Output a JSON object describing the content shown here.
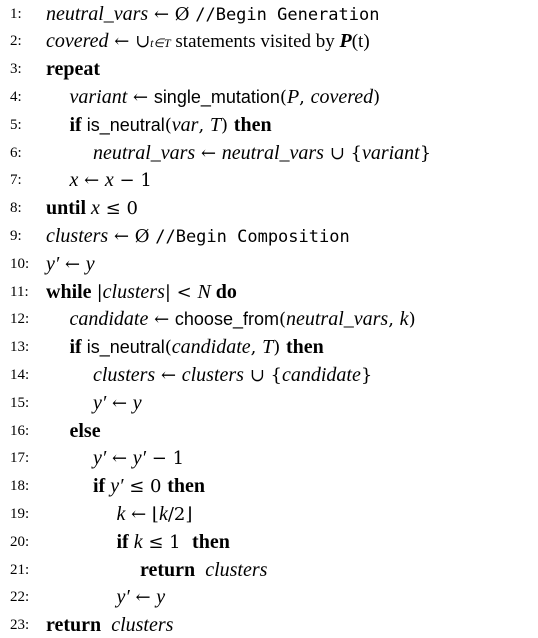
{
  "lines": [
    {
      "num": "1:",
      "indent": 0,
      "tokens": [
        {
          "t": "neutral_vars",
          "c": "v"
        },
        {
          "t": " ← Ø ",
          "c": "op"
        },
        {
          "t": "//Begin Generation",
          "c": "tt"
        }
      ]
    },
    {
      "num": "2:",
      "indent": 0,
      "tokens": [
        {
          "t": "covered",
          "c": "v"
        },
        {
          "t": " ← ∪",
          "c": "op"
        },
        {
          "t": "t∈T",
          "c": "v sub"
        },
        {
          "t": " statements visited by ",
          "c": "tx"
        },
        {
          "t": "P",
          "c": "v kw"
        },
        {
          "t": "(t)",
          "c": "tx"
        }
      ]
    },
    {
      "num": "3:",
      "indent": 0,
      "tokens": [
        {
          "t": "repeat",
          "c": "kw"
        }
      ]
    },
    {
      "num": "4:",
      "indent": 1,
      "tokens": [
        {
          "t": "variant",
          "c": "v"
        },
        {
          "t": " ← ",
          "c": "op"
        },
        {
          "t": "single_mutation",
          "c": "fn"
        },
        {
          "t": "(",
          "c": "op"
        },
        {
          "t": "P",
          "c": "v"
        },
        {
          "t": ", ",
          "c": "op"
        },
        {
          "t": "covered",
          "c": "v"
        },
        {
          "t": ")",
          "c": "op"
        }
      ]
    },
    {
      "num": "5:",
      "indent": 1,
      "tokens": [
        {
          "t": "if ",
          "c": "kw"
        },
        {
          "t": "is_neutral",
          "c": "fn"
        },
        {
          "t": "(",
          "c": "op"
        },
        {
          "t": "var",
          "c": "v"
        },
        {
          "t": ", ",
          "c": "op"
        },
        {
          "t": "T",
          "c": "v"
        },
        {
          "t": ") ",
          "c": "op"
        },
        {
          "t": "then",
          "c": "kw"
        }
      ]
    },
    {
      "num": "6:",
      "indent": 2,
      "tokens": [
        {
          "t": "neutral_vars",
          "c": "v"
        },
        {
          "t": " ← ",
          "c": "op"
        },
        {
          "t": "neutral_vars",
          "c": "v"
        },
        {
          "t": " ∪ {",
          "c": "op"
        },
        {
          "t": "variant",
          "c": "v"
        },
        {
          "t": "}",
          "c": "op"
        }
      ]
    },
    {
      "num": "7:",
      "indent": 1,
      "tokens": [
        {
          "t": "x",
          "c": "v"
        },
        {
          "t": " ← ",
          "c": "op"
        },
        {
          "t": "x",
          "c": "v"
        },
        {
          "t": " − 1",
          "c": "op"
        }
      ]
    },
    {
      "num": "8:",
      "indent": 0,
      "tokens": [
        {
          "t": "until ",
          "c": "kw"
        },
        {
          "t": "x",
          "c": "v"
        },
        {
          "t": " ≤ 0",
          "c": "op"
        }
      ]
    },
    {
      "num": "9:",
      "indent": 0,
      "tokens": [
        {
          "t": "clusters",
          "c": "v"
        },
        {
          "t": " ← Ø ",
          "c": "op"
        },
        {
          "t": "//Begin Composition",
          "c": "tt"
        }
      ]
    },
    {
      "num": "10:",
      "indent": 0,
      "tokens": [
        {
          "t": "y′",
          "c": "v"
        },
        {
          "t": " ← ",
          "c": "op"
        },
        {
          "t": "y",
          "c": "v"
        }
      ]
    },
    {
      "num": "11:",
      "indent": 0,
      "tokens": [
        {
          "t": "while ",
          "c": "kw"
        },
        {
          "t": "|",
          "c": "op"
        },
        {
          "t": "clusters",
          "c": "v"
        },
        {
          "t": "| < ",
          "c": "op"
        },
        {
          "t": "N",
          "c": "v"
        },
        {
          "t": " do",
          "c": "kw"
        }
      ]
    },
    {
      "num": "12:",
      "indent": 1,
      "tokens": [
        {
          "t": "candidate",
          "c": "v"
        },
        {
          "t": " ← ",
          "c": "op"
        },
        {
          "t": "choose_from",
          "c": "fn"
        },
        {
          "t": "(",
          "c": "op"
        },
        {
          "t": "neutral_vars",
          "c": "v"
        },
        {
          "t": ", ",
          "c": "op"
        },
        {
          "t": "k",
          "c": "v"
        },
        {
          "t": ")",
          "c": "op"
        }
      ]
    },
    {
      "num": "13:",
      "indent": 1,
      "tokens": [
        {
          "t": "if ",
          "c": "kw"
        },
        {
          "t": "is_neutral",
          "c": "fn"
        },
        {
          "t": "(",
          "c": "op"
        },
        {
          "t": "candidate",
          "c": "v"
        },
        {
          "t": ", ",
          "c": "op"
        },
        {
          "t": "T",
          "c": "v"
        },
        {
          "t": ") ",
          "c": "op"
        },
        {
          "t": "then",
          "c": "kw"
        }
      ]
    },
    {
      "num": "14:",
      "indent": 2,
      "tokens": [
        {
          "t": "clusters",
          "c": "v"
        },
        {
          "t": " ← ",
          "c": "op"
        },
        {
          "t": "clusters",
          "c": "v"
        },
        {
          "t": " ∪ {",
          "c": "op"
        },
        {
          "t": "candidate",
          "c": "v"
        },
        {
          "t": "}",
          "c": "op"
        }
      ]
    },
    {
      "num": "15:",
      "indent": 2,
      "tokens": [
        {
          "t": "y′",
          "c": "v"
        },
        {
          "t": " ← ",
          "c": "op"
        },
        {
          "t": "y",
          "c": "v"
        }
      ]
    },
    {
      "num": "16:",
      "indent": 1,
      "tokens": [
        {
          "t": "else",
          "c": "kw"
        }
      ]
    },
    {
      "num": "17:",
      "indent": 2,
      "tokens": [
        {
          "t": "y′",
          "c": "v"
        },
        {
          "t": " ← ",
          "c": "op"
        },
        {
          "t": "y′",
          "c": "v"
        },
        {
          "t": " − 1",
          "c": "op"
        }
      ]
    },
    {
      "num": "18:",
      "indent": 2,
      "tokens": [
        {
          "t": "if ",
          "c": "kw"
        },
        {
          "t": "y′",
          "c": "v"
        },
        {
          "t": " ≤ 0 ",
          "c": "op"
        },
        {
          "t": "then",
          "c": "kw"
        }
      ]
    },
    {
      "num": "19:",
      "indent": 3,
      "tokens": [
        {
          "t": "k",
          "c": "v"
        },
        {
          "t": " ← ⌊",
          "c": "op"
        },
        {
          "t": "k",
          "c": "v"
        },
        {
          "t": "/2⌋",
          "c": "op"
        }
      ]
    },
    {
      "num": "20:",
      "indent": 3,
      "tokens": [
        {
          "t": "if ",
          "c": "kw"
        },
        {
          "t": "k",
          "c": "v"
        },
        {
          "t": " ≤ 1  ",
          "c": "op"
        },
        {
          "t": "then",
          "c": "kw"
        }
      ]
    },
    {
      "num": "21:",
      "indent": 4,
      "tokens": [
        {
          "t": "return ",
          "c": "kw"
        },
        {
          "t": " clusters",
          "c": "v"
        }
      ]
    },
    {
      "num": "22:",
      "indent": 3,
      "tokens": [
        {
          "t": "y′",
          "c": "v"
        },
        {
          "t": " ← ",
          "c": "op"
        },
        {
          "t": "y",
          "c": "v"
        }
      ]
    },
    {
      "num": "23:",
      "indent": 0,
      "tokens": [
        {
          "t": "return ",
          "c": "kw"
        },
        {
          "t": " clusters",
          "c": "v"
        }
      ]
    }
  ]
}
